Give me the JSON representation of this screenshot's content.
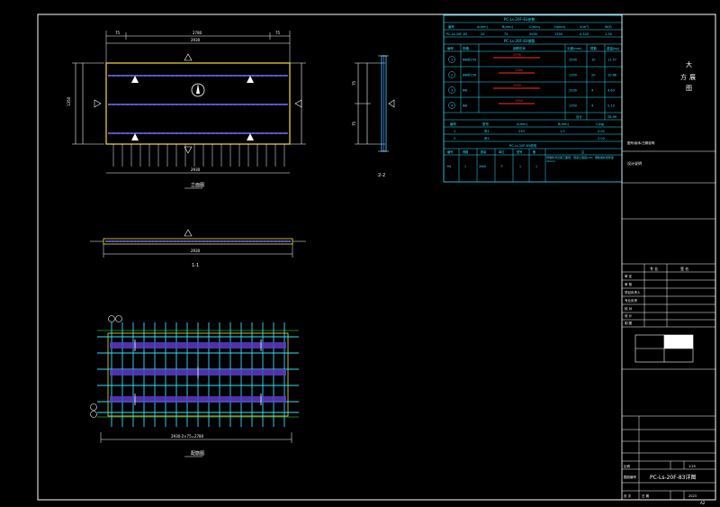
{
  "drawing": {
    "title_block": {
      "vertical_note_top": "大",
      "vertical_note_mid": "方",
      "vertical_note_mid2": "展",
      "vertical_note_bottom": "图",
      "small_note": "图号/版本/日期说明",
      "remark_label": "设计说明",
      "signoff_header_left": "专 业",
      "signoff_header_right": "签 名",
      "row_labels": [
        "审 定",
        "审 核",
        "项目负责人",
        "专业负责",
        "校 对",
        "设 计",
        "制 图"
      ],
      "scale_label": "比例",
      "scale_value": "1:25",
      "drawing_no_label": "图纸编号",
      "drawing_name": "PC-Ls-20F-83详图",
      "date_label": "日 期",
      "date_value": "2023",
      "sheet_label": "页 次"
    },
    "views": {
      "plan_label": "立面图",
      "section1_label": "1-1",
      "section2_label": "2-2",
      "bottom_label": "配筋图"
    },
    "tables": {
      "t1_title": "PC-Ls-20F-83参数",
      "t1_headers": [
        "编号",
        "A(mm)",
        "B(mm)",
        "C(mm)",
        "H(mm)",
        "V(m³)",
        "W(t)"
      ],
      "t1_row": [
        "PC-Ls-20F-83",
        "20",
        "75",
        "2930",
        "1350",
        "0.520",
        "1.30"
      ],
      "t2_title": "PC-Ls-20F-83钢筋",
      "t2_headers": [
        "编号",
        "规格",
        "钢筋形状",
        "长度(mm)",
        "根数",
        "重量(kg)"
      ],
      "t2_rows": [
        [
          "1",
          "Φ8@150",
          "2930",
          "2930",
          "10",
          "11.57"
        ],
        [
          "2",
          "Φ8@150",
          "1350",
          "1350",
          "20",
          "10.66"
        ],
        [
          "3",
          "Φ8",
          "2930",
          "2930",
          "4",
          "4.63"
        ],
        [
          "4",
          "Φ8",
          "1350",
          "1350",
          "4",
          "2.13"
        ]
      ],
      "t2_total_label": "合计",
      "t2_total": "28.99",
      "t3_headers": [
        "编号",
        "型号",
        "A(mm)",
        "B(mm)",
        "C(kg)"
      ],
      "t3_rows": [
        [
          "1",
          "吊1",
          "230",
          "1.0",
          "2.02"
        ],
        [
          "2",
          "吊2",
          "",
          "",
          "2.02"
        ]
      ],
      "t4_title": "PC-Ls-20F-83说明",
      "t4_headers": [
        "编号",
        "规格",
        "数量",
        "单位",
        "型号",
        "备",
        "注"
      ],
      "t4_row": [
        "M1",
        "1",
        "2000",
        "个",
        "1",
        "1",
        "预埋件详见施工图纸，混凝土强度C30，钢筋保护层厚度20mm"
      ]
    },
    "dims": {
      "total_length": "2930",
      "seg_a": "75",
      "seg_mid": "2780",
      "width": "1350",
      "bottom_total": "2930-2×75=2780",
      "side_a": "25",
      "side_b": "75"
    },
    "colors": {
      "line": "#ffffff",
      "cyan": "#33e0ff",
      "yellow": "#f0e040",
      "purple": "#7060ff",
      "green": "#40ff40",
      "red": "#ff3030"
    },
    "page_number": "A2"
  }
}
